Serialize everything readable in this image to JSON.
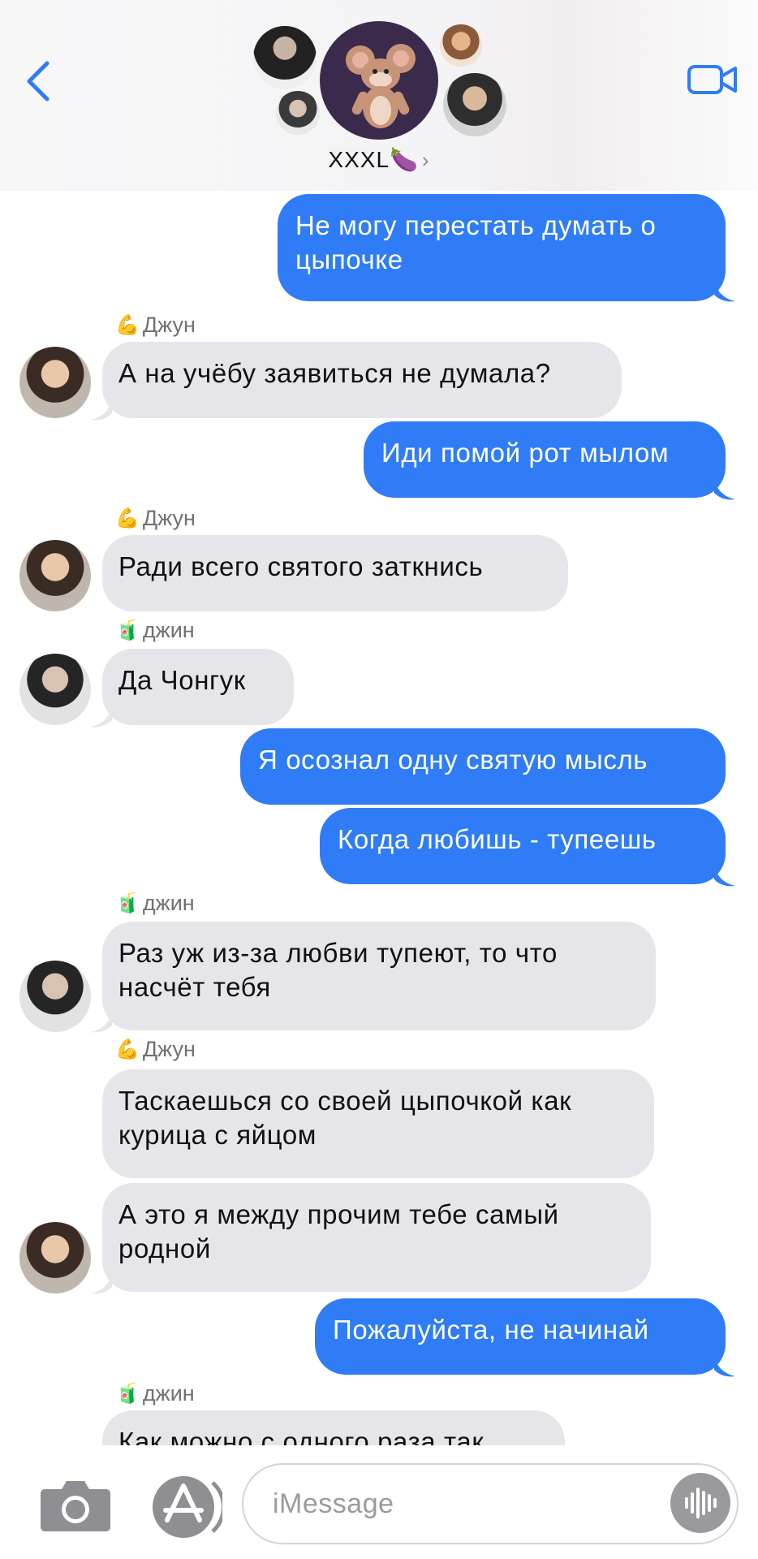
{
  "header": {
    "group_name": "XXXL🍆",
    "chevron": "›",
    "icons": {
      "back": "chevron-left-icon",
      "video": "video-camera-icon"
    }
  },
  "colors": {
    "outgoing": "#2f7cf6",
    "incoming": "#e6e5ea",
    "accent": "#2f7cf6"
  },
  "messages": [
    {
      "dir": "out",
      "text_lines": [
        "Не могу перестать думать о",
        "цыпочке"
      ]
    },
    {
      "dir": "in",
      "sender_emoji": "💪",
      "sender": "Джун",
      "text_lines": [
        "А на учёбу заявиться не думала?"
      ]
    },
    {
      "dir": "out",
      "text_lines": [
        "Иди помой рот мылом"
      ]
    },
    {
      "dir": "in",
      "sender_emoji": "💪",
      "sender": "Джун",
      "text_lines": [
        "Ради всего святого заткнись"
      ]
    },
    {
      "dir": "in",
      "sender_emoji": "🧃",
      "sender": "джин",
      "text_lines": [
        "Да Чонгук"
      ]
    },
    {
      "dir": "out",
      "text_lines": [
        "Я осознал одну святую мысль"
      ]
    },
    {
      "dir": "out",
      "text_lines": [
        "Когда любишь  - тупеешь"
      ]
    },
    {
      "dir": "in",
      "sender_emoji": "🧃",
      "sender": "джин",
      "text_lines": [
        "Раз уж из-за любви тупеют,  то что",
        "насчёт тебя"
      ]
    },
    {
      "dir": "in",
      "sender_emoji": "💪",
      "sender": "Джун",
      "text_lines": [
        "Таскаешься со своей цыпочкой как",
        "курица с яйцом"
      ]
    },
    {
      "dir": "in",
      "text_lines": [
        "А это я между прочим  тебе самый",
        "родной"
      ]
    },
    {
      "dir": "out",
      "text_lines": [
        "Пожалуйста,  не начинай"
      ]
    },
    {
      "dir": "in",
      "sender_emoji": "🧃",
      "sender": "джин",
      "text_lines": [
        "Как можно с одного раза так"
      ]
    }
  ],
  "composer": {
    "placeholder": "iMessage",
    "icons": {
      "camera": "camera-icon",
      "apps": "app-store-icon",
      "audio": "audio-waveform-icon"
    }
  }
}
